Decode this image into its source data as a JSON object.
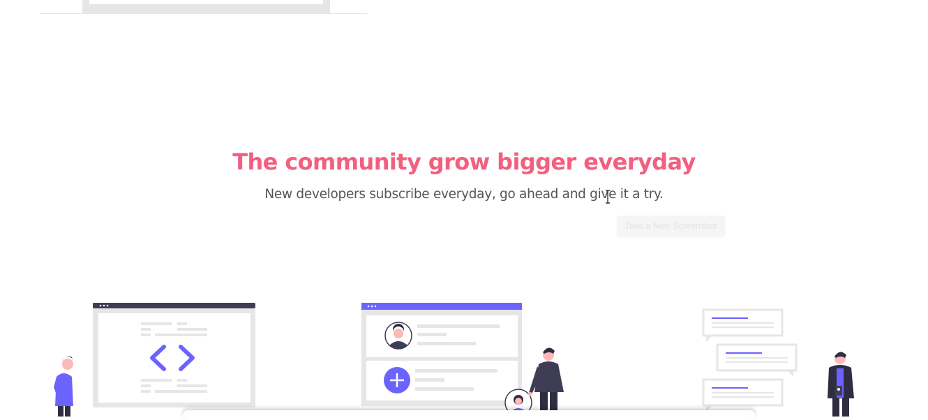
{
  "section": {
    "title": "The community grow bigger everyday",
    "subtitle": "New developers subscribe everyday, go ahead and give it a try.",
    "title_color": "#f25f7f"
  },
  "overlay": {
    "screenshot_button_label": "Take a New Screenshot"
  },
  "colors": {
    "accent_purple": "#6c63ff",
    "dark_navy": "#3f3d56",
    "light_gray": "#e6e6e6"
  },
  "icons": {
    "code": "code-brackets-icon",
    "add": "plus-icon",
    "cursor": "text-cursor-icon"
  }
}
